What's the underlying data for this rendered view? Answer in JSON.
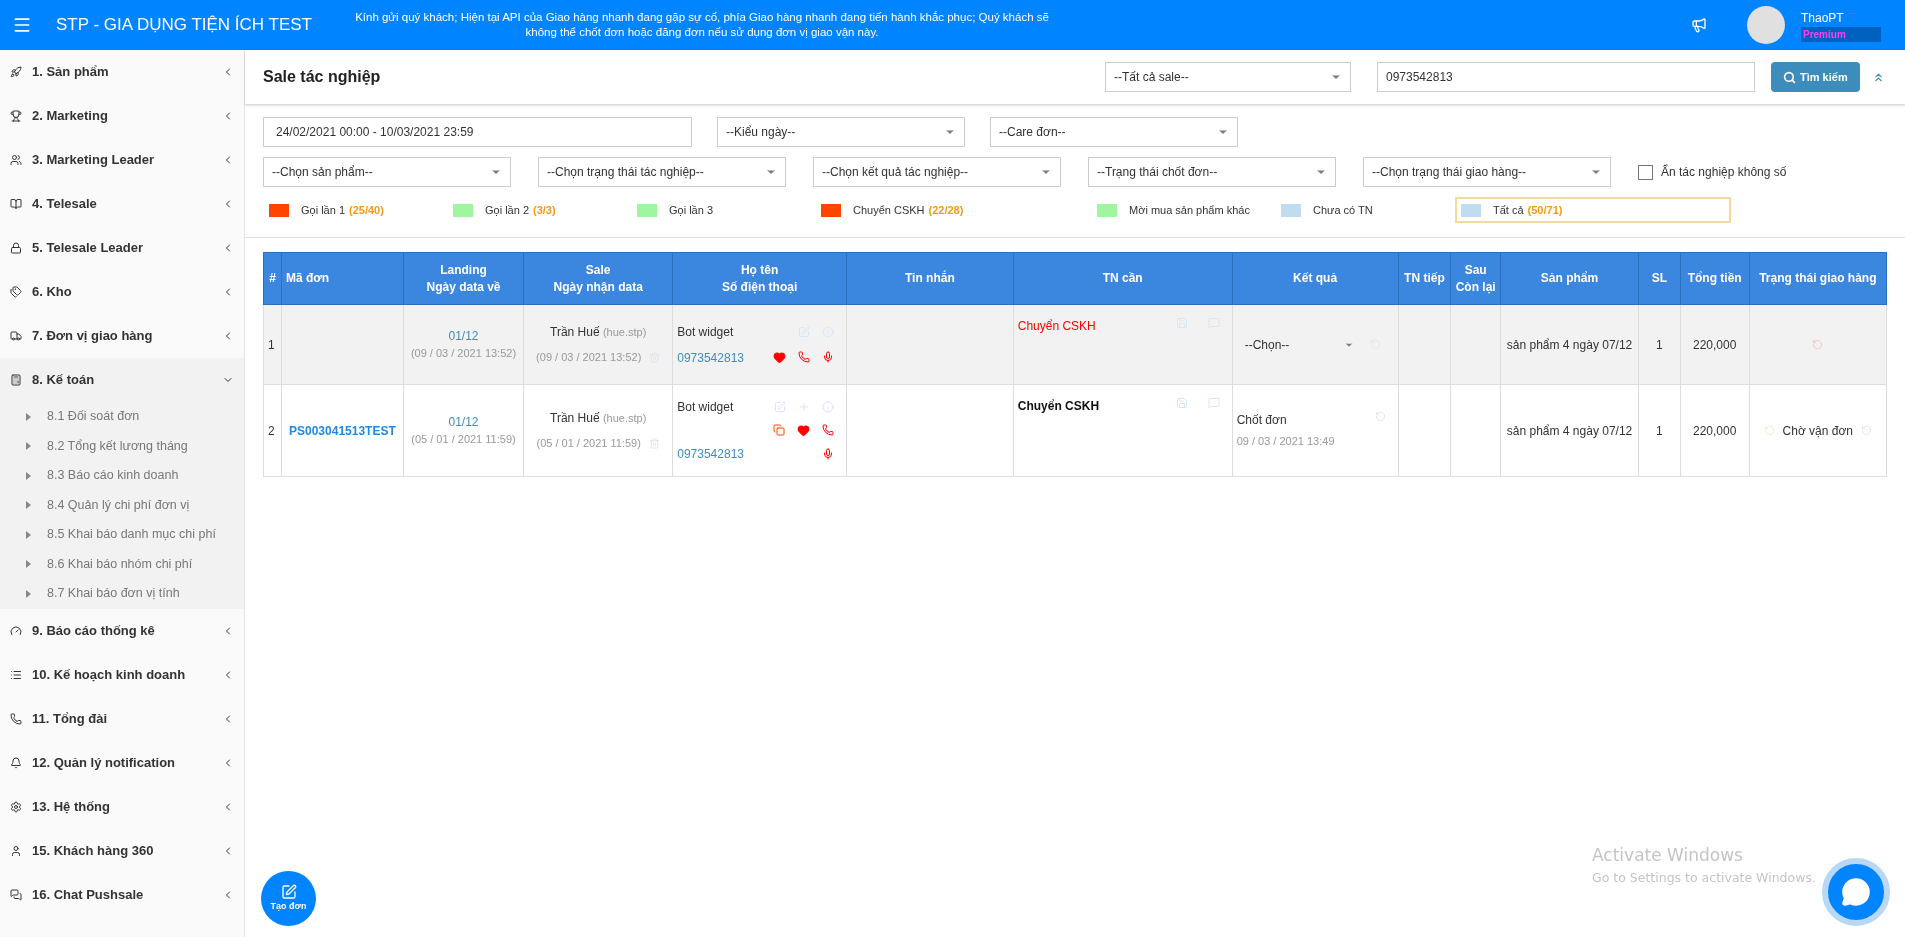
{
  "header": {
    "brand": "STP - GIA DỤNG TIỆN ÍCH TEST",
    "notice": "Kính gửi quý khách; Hiện tại API của Giao hàng nhanh đang gặp sự cố, phía Giao hàng nhanh đang tiến hành khắc phục; Quý khách sẽ không thể chốt đơn hoặc đăng đơn nếu sử dụng đơn vị giao vận này.",
    "user": "ThaoPT",
    "plan": "Premium"
  },
  "sidebar": {
    "items": [
      {
        "label": "1. Sản phẩm",
        "expanded": false
      },
      {
        "label": "2. Marketing",
        "expanded": false
      },
      {
        "label": "3. Marketing Leader",
        "expanded": false
      },
      {
        "label": "4. Telesale",
        "expanded": false
      },
      {
        "label": "5. Telesale Leader",
        "expanded": false
      },
      {
        "label": "6. Kho",
        "expanded": false
      },
      {
        "label": "7. Đơn vị giao hàng",
        "expanded": false
      },
      {
        "label": "8. Kế toán",
        "expanded": true,
        "children": [
          {
            "label": "8.1 Đối soát đơn"
          },
          {
            "label": "8.2 Tổng kết lương tháng"
          },
          {
            "label": "8.3 Báo cáo kinh doanh"
          },
          {
            "label": "8.4 Quản lý chi phí đơn vị"
          },
          {
            "label": "8.5 Khai báo danh mục chi phí"
          },
          {
            "label": "8.6 Khai báo nhóm chi phí"
          },
          {
            "label": "8.7 Khai báo đơn vị tính"
          }
        ]
      },
      {
        "label": "9. Báo cáo thống kê",
        "expanded": false
      },
      {
        "label": "10. Kế hoạch kinh doanh",
        "expanded": false
      },
      {
        "label": "11. Tổng đài",
        "expanded": false
      },
      {
        "label": "12. Quản lý notification",
        "expanded": false
      },
      {
        "label": "13. Hệ thống",
        "expanded": false
      },
      {
        "label": "15. Khách hàng 360",
        "expanded": false
      },
      {
        "label": "16. Chat Pushsale",
        "expanded": false
      }
    ]
  },
  "page": {
    "title": "Sale tác nghiệp",
    "sale_select": "--Tất cả sale--",
    "search_value": "0973542813",
    "search_button": "Tìm kiếm"
  },
  "filters": {
    "date_range": "24/02/2021 00:00 - 10/03/2021 23:59",
    "row1": [
      "--Kiểu ngày--",
      "--Care đơn--"
    ],
    "row2": [
      "--Chọn sản phẩm--",
      "--Chọn trạng thái tác nghiệp--",
      "--Chọn kết quả tác nghiệp--",
      "--Trạng thái chốt đơn--",
      "--Chọn trạng thái giao hàng--"
    ],
    "hide_checkbox": {
      "label": "Ẩn tác nghiệp không số",
      "checked": false
    }
  },
  "legend": [
    {
      "label": "Gọi lần 1",
      "count": "(25/40)",
      "color": "#ff4500",
      "selected": false
    },
    {
      "label": "Gọi lần 2",
      "count": "(3/3)",
      "color": "#a0f5a0",
      "selected": false
    },
    {
      "label": "Gọi lần 3",
      "color": "#a0f5a0",
      "selected": false
    },
    {
      "label": "Chuyển CSKH",
      "count": "(22/28)",
      "color": "#ff4500",
      "selected": false
    },
    {
      "label": "Mời mua sản phẩm khác",
      "color": "#a0f5a0",
      "selected": false
    },
    {
      "label": "Chưa có TN",
      "color": "#c0dcf0",
      "selected": false
    },
    {
      "label": "Tất cả",
      "count": "(50/71)",
      "color": "#c0dcf0",
      "selected": true
    }
  ],
  "table": {
    "columns": [
      "#",
      "Mã đơn",
      "Landing\nNgày data về",
      "Sale\nNgày nhận data",
      "Họ tên\nSố điện thoại",
      "Tin nhắn",
      "TN cần",
      "Kết quả",
      "TN tiếp",
      "Sau\nCòn lại",
      "Sản phẩm",
      "SL",
      "Tổng tiền",
      "Trạng thái giao hàng"
    ],
    "rows": [
      {
        "index": "1",
        "code": "",
        "landing": "01/12",
        "landing_date": "(09 / 03 / 2021 13:52)",
        "sale": "Trần Huế",
        "sale_user": "(hue.stp)",
        "sale_date": "(09 / 03 / 2021 13:52)",
        "name": "Bot widget",
        "phone": "0973542813",
        "tn_can": {
          "kind": "alert",
          "text": "Chuyển CSKH"
        },
        "result": {
          "kind": "select",
          "text": "--Chọn--"
        },
        "product": "sản phẩm 4 ngày 07/12",
        "qty": "1",
        "total": "220,000"
      },
      {
        "index": "2",
        "code": "PS003041513TEST",
        "landing": "01/12",
        "landing_date": "(05 / 01 / 2021 11:59)",
        "sale": "Trần Huế",
        "sale_user": "(hue.stp)",
        "sale_date": "(05 / 01 / 2021 11:59)",
        "name": "Bot widget",
        "phone": "0973542813",
        "tn_can": {
          "kind": "normal",
          "text": "Chuyển CSKH"
        },
        "result": {
          "kind": "text",
          "text": "Chốt đơn",
          "time": "09 / 03 / 2021 13:49"
        },
        "product": "sản phẩm 4 ngày 07/12",
        "qty": "1",
        "total": "220,000",
        "delivery": "Chờ vận đơn"
      }
    ]
  },
  "fab": {
    "label": "Tạo đơn"
  },
  "os_notice": {
    "title": "Activate Windows",
    "subtitle": "Go to Settings to activate Windows."
  }
}
